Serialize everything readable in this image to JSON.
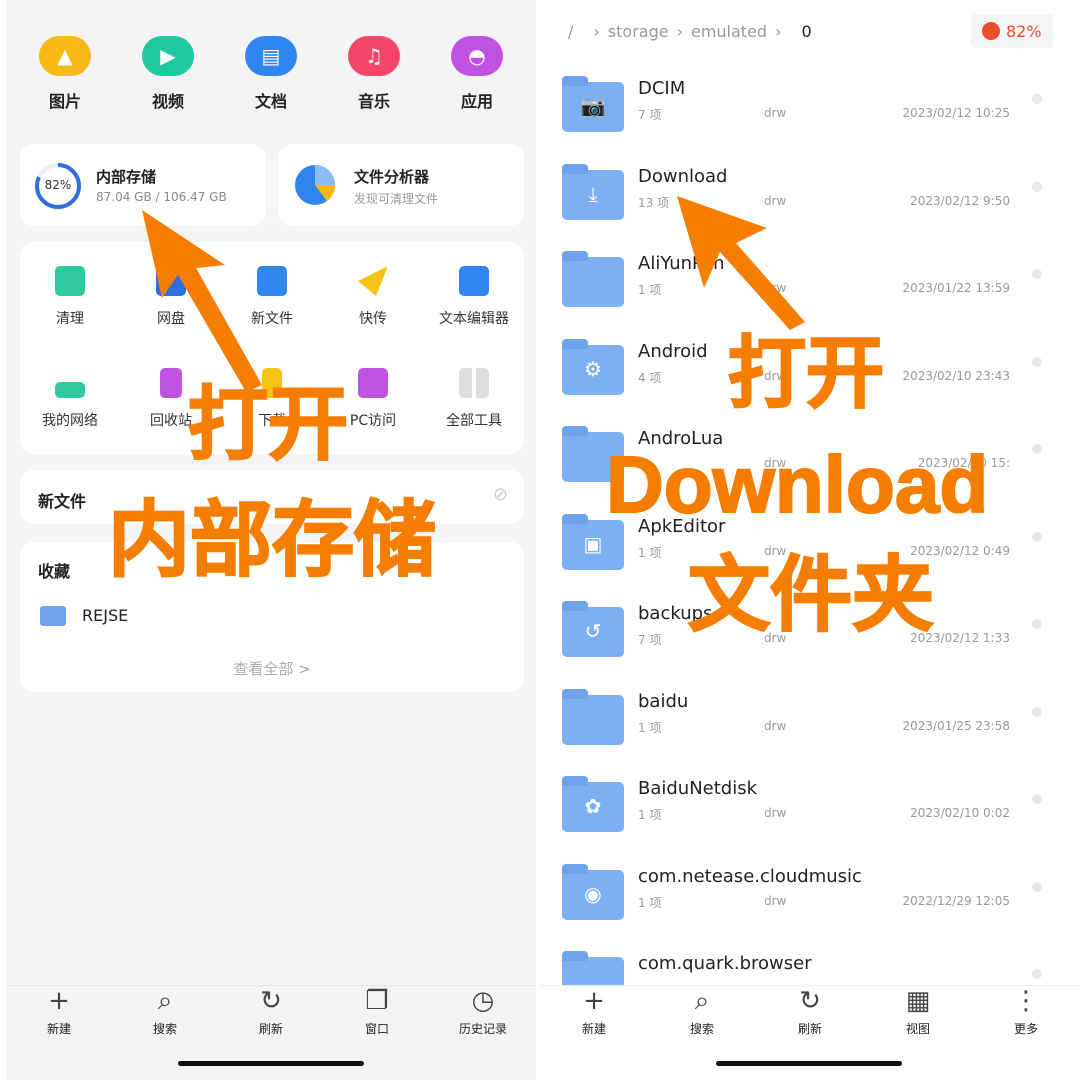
{
  "left": {
    "categories": [
      {
        "label": "图片",
        "icon": "image-icon",
        "color": "#f7b916"
      },
      {
        "label": "视频",
        "icon": "video-icon",
        "color": "#1ec9a2"
      },
      {
        "label": "文档",
        "icon": "document-icon",
        "color": "#2e86ee"
      },
      {
        "label": "音乐",
        "icon": "music-icon",
        "color": "#f3466a"
      },
      {
        "label": "应用",
        "icon": "android-icon",
        "color": "#c052e0"
      }
    ],
    "storage": {
      "percent": "82%",
      "title": "内部存储",
      "usage": "87.04 GB / 106.47 GB",
      "fraction": 0.82
    },
    "analyzer": {
      "title": "文件分析器",
      "subtitle": "发现可清理文件"
    },
    "tools": [
      "清理",
      "网盘",
      "新文件",
      "快传",
      "文本编辑器",
      "我的网络",
      "回收站",
      "下载",
      "PC访问",
      "全部工具"
    ],
    "recent": {
      "title": "新文件"
    },
    "favorites": {
      "title": "收藏",
      "items": [
        "REJSE"
      ],
      "view_all": "查看全部 >"
    },
    "nav": [
      "新建",
      "搜索",
      "刷新",
      "窗口",
      "历史记录"
    ]
  },
  "right": {
    "breadcrumb": [
      "/",
      "storage",
      "emulated",
      "0"
    ],
    "storage_badge": "82%",
    "folders": [
      {
        "name": "DCIM",
        "count": "7 项",
        "perm": "drw",
        "date": "2023/02/12 10:25"
      },
      {
        "name": "Download",
        "count": "13 项",
        "perm": "drw",
        "date": "2023/02/12 9:50"
      },
      {
        "name": "AliYunPan",
        "count": "1 项",
        "perm": "drw",
        "date": "2023/01/22 13:59"
      },
      {
        "name": "Android",
        "count": "4 项",
        "perm": "drw",
        "date": "2023/02/10 23:43"
      },
      {
        "name": "AndroLua",
        "count": "",
        "perm": "drw",
        "date": "2023/02/10 15:"
      },
      {
        "name": "ApkEditor",
        "count": "1 项",
        "perm": "drw",
        "date": "2023/02/12 0:49"
      },
      {
        "name": "backups",
        "count": "7 项",
        "perm": "drw",
        "date": "2023/02/12 1:33"
      },
      {
        "name": "baidu",
        "count": "1 项",
        "perm": "drw",
        "date": "2023/01/25 23:58"
      },
      {
        "name": "BaiduNetdisk",
        "count": "1 项",
        "perm": "drw",
        "date": "2023/02/10 0:02"
      },
      {
        "name": "com.netease.cloudmusic",
        "count": "1 项",
        "perm": "drw",
        "date": "2022/12/29 12:05"
      },
      {
        "name": "com.quark.browser",
        "count": "",
        "perm": "",
        "date": ""
      }
    ],
    "nav": [
      "新建",
      "搜索",
      "刷新",
      "视图",
      "更多"
    ]
  },
  "annotations": {
    "left_open": "打开",
    "left_target": "内部存储",
    "right_open": "打开",
    "right_target": "Download",
    "right_suffix": "文件夹",
    "color": "#f57d00"
  }
}
